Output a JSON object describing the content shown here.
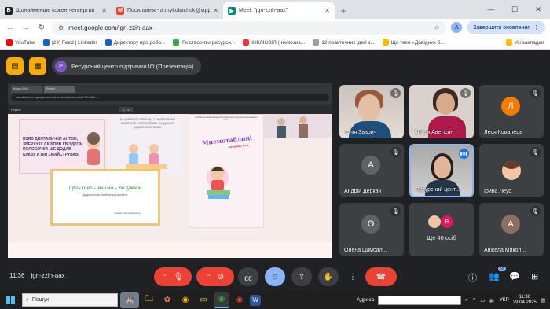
{
  "browser": {
    "tabs": [
      {
        "favicon": "Б",
        "title": "Щонайменше кожен четвертий",
        "active": false
      },
      {
        "favicon": "M",
        "title": "Посилання - a.mykolaichuk@vipp",
        "active": false
      },
      {
        "favicon": "▶",
        "title": "Meet: \"jgn-zzih-aax\"",
        "active": true
      }
    ],
    "new_tab": "+",
    "url": "meet.google.com/jgn-zzih-aax",
    "profile_initial": "A",
    "update_button": "Завершити оновлення",
    "bookmarks": [
      {
        "label": "YouTube",
        "color": "#ff0000"
      },
      {
        "label": "(29) Feed | LinkedIn",
        "color": "#0a66c2"
      },
      {
        "label": "Директору про робо...",
        "color": "#1565c0"
      },
      {
        "label": "Як створити ресурсн...",
        "color": "#34a853"
      },
      {
        "label": "ІНКЛЮЗІЯ (Інклюзив...",
        "color": "#e53935"
      },
      {
        "label": "12 практичних ідей з...",
        "color": "#9e9e9e"
      },
      {
        "label": "Що таке «Довідник б...",
        "color": "#fbbc04"
      }
    ],
    "all_bookmarks": "Усі закладки"
  },
  "meet": {
    "presentation_title": "Ресурсний центр підтримки ІО (Презентація)",
    "presenter_initial": "Р",
    "meeting_code": "jgn-zzih-aax",
    "time": "11:36",
    "participants_count": "55",
    "shared": {
      "inner_tabs": [
        "Вхідні (664) - ...",
        "Project"
      ],
      "inner_url": "mail-attachment.googleusercontent.com/attachment/u/0/?ui=2&ik=...",
      "project_label": "Project",
      "page_indicator": "1 / 32",
      "card1_text": "ВЗЯВ ДВІ ПАЛИЧКИ АНТОН, ЗВЕРХУ ЇХ СКРІПИВ ГВІЗДКОМ. ПОЛОСОЧКА ЩЕ ДОДАВ – БУКВУ А ВІН ЗМАЙСТРУВАВ.",
      "card2_text": "на роботі з дітьми з особливими освітніми потребами на уроках української мови",
      "card3_header": "Волинська обласна рада Ресурсний центр підтримки інклюзивної освіти",
      "card3_title": "Мнемотаблиці",
      "card3_subtitle": "читання 2 клас",
      "card5_title": "Грайливо – вчимо – розумієм",
      "card5_sub": "Дидактичний посібник для вчителя",
      "card5_author": "Укладач: Ольга Миколайчук"
    },
    "tiles": [
      {
        "name": "Юлія Зварич",
        "type": "photo1"
      },
      {
        "name": "Артем Аветісян",
        "type": "photo2"
      },
      {
        "name": "Леся Ковалець",
        "initial": "Л",
        "color": "#f57c00"
      },
      {
        "name": "Андрій Деркач",
        "initial": "А",
        "color": "#5f6368"
      },
      {
        "name": "Ресурсний цент...",
        "type": "photo3"
      },
      {
        "name": "Ірина Леус",
        "type": "mini"
      },
      {
        "name": "Олена Цимбал...",
        "initial": "О",
        "color": "#5f6368"
      },
      {
        "name": "Ще 46 осіб",
        "type": "more",
        "extra_initial": "В"
      },
      {
        "name": "Анжела Микол...",
        "initial": "А",
        "color": "#8d6e63"
      }
    ]
  },
  "taskbar": {
    "search_placeholder": "Пошук",
    "address_label": "Адреса",
    "lang": "УКР",
    "time": "11:36",
    "date": "29.04.2025"
  }
}
